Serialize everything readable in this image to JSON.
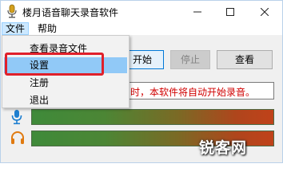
{
  "window": {
    "title": "楼月语音聊天录音软件"
  },
  "menubar": {
    "file_label": "文件",
    "help_label": "帮助"
  },
  "file_menu": {
    "items": [
      "查看录音文件",
      "设置",
      "注册",
      "退出"
    ],
    "selected": "设置"
  },
  "toolbar": {
    "start_label": "开始",
    "stop_label": "停止",
    "view_label": "查看"
  },
  "notice": {
    "text": "时，本软件将自动开始录音。"
  },
  "icons": {
    "mic": "microphone-icon",
    "headphones": "headphones-icon"
  },
  "colors": {
    "menu_hover": "#91c9f7",
    "annotation_box": "#e0202a",
    "notice_text": "#d00000"
  },
  "watermark": {
    "text": "锐客网"
  }
}
